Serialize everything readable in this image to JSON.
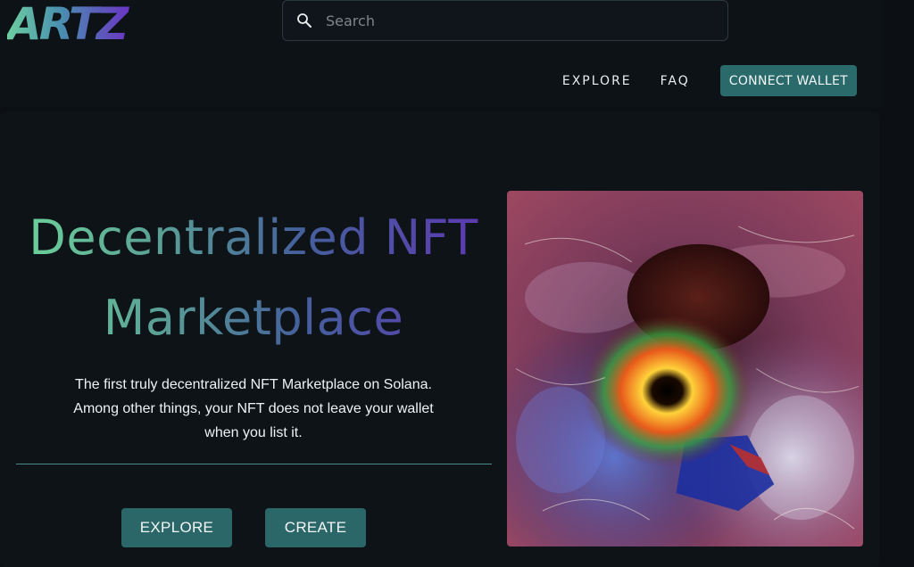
{
  "brand": {
    "logo_text": "ARTZ"
  },
  "search": {
    "placeholder": "Search"
  },
  "nav": {
    "explore_label": "EXPLORE",
    "faq_label": "FAQ",
    "connect_label": "CONNECT WALLET"
  },
  "hero": {
    "title_line1": "Decentralized NFT",
    "title_line2": "Marketplace",
    "description": "The first truly decentralized NFT Marketplace on Solana. Among other things, your NFT does not leave your wallet when you list it.",
    "explore_label": "EXPLORE",
    "create_label": "CREATE",
    "image_name": "nft-artwork"
  },
  "colors": {
    "accent": "#2b6768",
    "background": "#0c1014",
    "gradient_start": "#6dd49a",
    "gradient_end": "#5d38b3"
  }
}
